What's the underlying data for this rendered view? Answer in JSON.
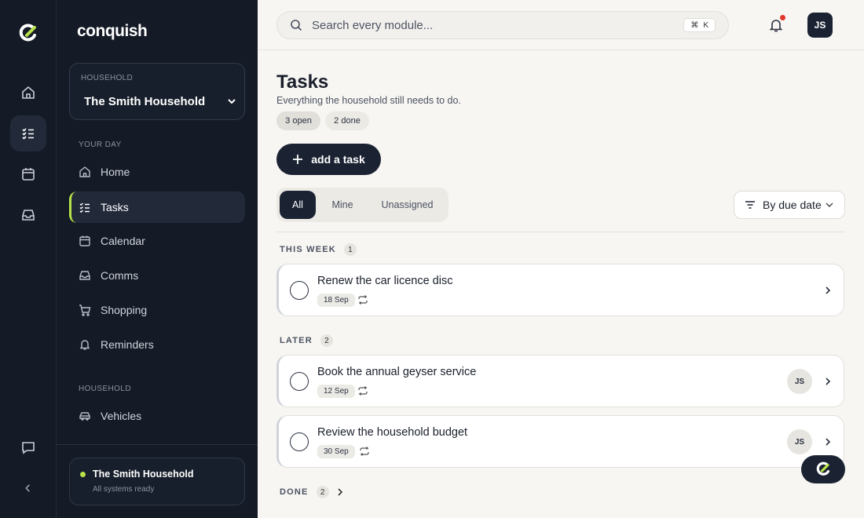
{
  "app": {
    "brand": "conquish"
  },
  "household": {
    "label": "HOUSEHOLD",
    "name": "The Smith Household"
  },
  "sidebar": {
    "sections": [
      {
        "label": "YOUR DAY",
        "items": [
          {
            "label": "Home",
            "icon": "home-icon"
          },
          {
            "label": "Tasks",
            "icon": "tasks-icon",
            "active": true
          },
          {
            "label": "Calendar",
            "icon": "calendar-icon"
          },
          {
            "label": "Comms",
            "icon": "inbox-icon"
          },
          {
            "label": "Shopping",
            "icon": "cart-icon"
          },
          {
            "label": "Reminders",
            "icon": "bell-icon"
          }
        ]
      },
      {
        "label": "HOUSEHOLD",
        "items": [
          {
            "label": "Vehicles",
            "icon": "car-icon"
          }
        ]
      }
    ],
    "status": {
      "name": "The Smith Household",
      "text": "All systems ready",
      "color": "#b8e24a"
    }
  },
  "search": {
    "placeholder": "Search every module...",
    "shortcut_symbol": "⌘",
    "shortcut_key": "K"
  },
  "user": {
    "initials": "JS"
  },
  "page": {
    "title": "Tasks",
    "subtitle": "Everything the household still needs to do.",
    "open_pill": "3 open",
    "done_pill": "2 done",
    "add_label": "add a task",
    "filters": [
      "All",
      "Mine",
      "Unassigned"
    ],
    "active_filter": "All",
    "sort_label": "By due date"
  },
  "groups": {
    "this_week": {
      "label": "THIS WEEK",
      "count": "1",
      "tasks": [
        {
          "title": "Renew the car licence disc",
          "date": "18 Sep",
          "assignee": ""
        }
      ]
    },
    "later": {
      "label": "LATER",
      "count": "2",
      "tasks": [
        {
          "title": "Book the annual geyser service",
          "date": "12 Sep",
          "assignee": "JS"
        },
        {
          "title": "Review the household budget",
          "date": "30 Sep",
          "assignee": "JS"
        }
      ]
    },
    "done": {
      "label": "DONE",
      "count": "2"
    }
  },
  "colors": {
    "accent": "#b8e24a",
    "dark": "#1b2333",
    "sidebar": "#141a26",
    "badge": "#e2362c"
  }
}
